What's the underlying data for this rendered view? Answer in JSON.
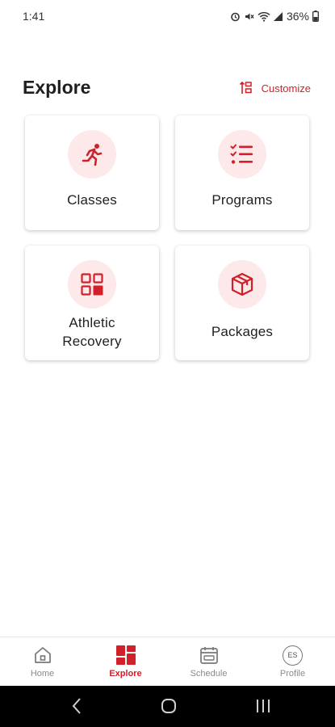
{
  "status": {
    "time": "1:41",
    "battery": "36%"
  },
  "header": {
    "title": "Explore",
    "customize_label": "Customize"
  },
  "cards": [
    {
      "label": "Classes"
    },
    {
      "label": "Programs"
    },
    {
      "label_line1": "Athletic",
      "label_line2": "Recovery"
    },
    {
      "label": "Packages"
    }
  ],
  "nav": {
    "items": [
      {
        "label": "Home"
      },
      {
        "label": "Explore"
      },
      {
        "label": "Schedule"
      },
      {
        "label": "Profile",
        "avatar_initials": "ES"
      }
    ],
    "active": "Explore"
  },
  "colors": {
    "accent": "#d1202a",
    "icon_bg": "#fde8ea",
    "inactive": "#8a8a8a"
  }
}
